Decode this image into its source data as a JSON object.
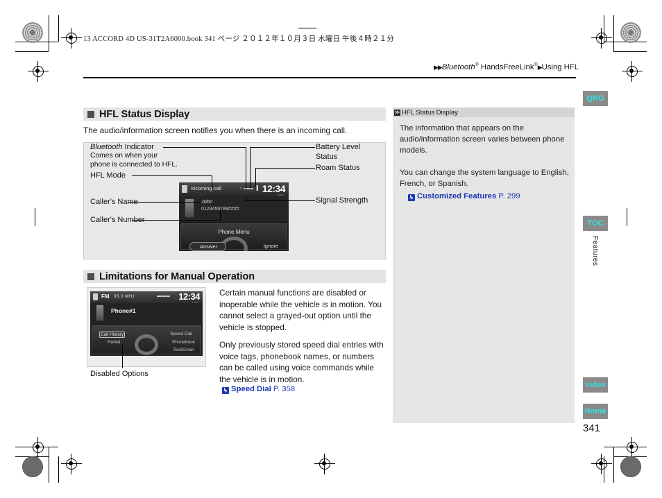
{
  "print_info": "13 ACCORD 4D US-31T2A6000.book   341 ページ   ２０１２年１０月３日   水曜日   午後４時２１分",
  "breadcrumb": {
    "arrow1": "▶▶",
    "part1": "Bluetooth",
    "sup1": "®",
    "part2": "HandsFreeLink",
    "sup2": "®",
    "arrow2": "▶",
    "part3": "Using HFL"
  },
  "sections": [
    {
      "title": "HFL Status Display",
      "intro": "The audio/information screen notifies you when there is an incoming call."
    },
    {
      "title": "Limitations for Manual Operation",
      "para1": "Certain manual functions are disabled or inoperable while the vehicle is in motion. You cannot select a grayed-out option until the vehicle is stopped.",
      "para2": "Only previously stored speed dial entries with voice tags, phonebook names, or numbers can be called using voice commands while the vehicle is in motion.",
      "xref": {
        "arrow": "↳",
        "label": "Speed Dial",
        "page": "P. 358"
      }
    }
  ],
  "callouts": {
    "bt_indicator_title_italic": "Bluetooth",
    "bt_indicator_title_rest": " Indicator",
    "bt_indicator_desc": "Comes on when your\nphone is connected to HFL.",
    "hfl_mode": "HFL Mode",
    "callers_name": "Caller's Name",
    "callers_number": "Caller's Number",
    "battery_level": "Battery Level\nStatus",
    "roam_status": "Roam Status",
    "signal_strength": "Signal Strength",
    "disabled_options": "Disabled Options"
  },
  "device_incoming_call": {
    "mode_text": "Incoming call",
    "clock": "12:34",
    "status_icons": "▫ ▬▬ ▐",
    "volume": "VOL",
    "caller_name": "John",
    "caller_number": "0123456789####",
    "phone_menu": "Phone Menu",
    "answer": "Answer",
    "ignore": "Ignore"
  },
  "device_limitations": {
    "source": "FM",
    "frequency": "93.0 MHz",
    "status_icons": "▬▬▬",
    "clock": "12:34",
    "volume": "VOL",
    "phone_label": "Phone#1",
    "menu_items": [
      "Call History",
      "Redial",
      "Speed Dial",
      "Phonebook",
      "Text/Email"
    ]
  },
  "sidebar_note": {
    "icon_glyph": "≫",
    "header": "HFL Status Display",
    "para1": "The information that appears on the audio/information screen varies between phone models.",
    "para2": "You can change the system language to English, French, or Spanish.",
    "xref": {
      "arrow": "↳",
      "label": "Customized Features",
      "page": "P. 299"
    }
  },
  "tabs": {
    "qrg": "QRG",
    "toc": "TOC",
    "features": "Features",
    "index": "Index",
    "home": "Home"
  },
  "page_number": "341",
  "colors": {
    "tab_bg": "#8a8a8a",
    "tab_text": "#2ee6e6",
    "xref_blue": "#1c39b5",
    "section_header_bg": "#e3e3e3"
  }
}
